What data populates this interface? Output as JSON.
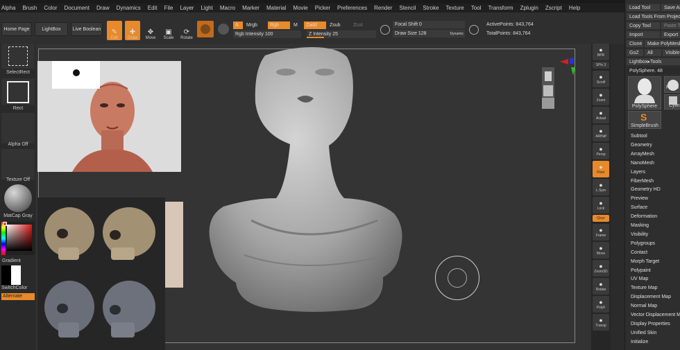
{
  "menu": [
    "Alpha",
    "Brush",
    "Color",
    "Document",
    "Draw",
    "Dynamics",
    "Edit",
    "File",
    "Layer",
    "Light",
    "Macro",
    "Marker",
    "Material",
    "Movie",
    "Picker",
    "Preferences",
    "Render",
    "Stencil",
    "Stroke",
    "Texture",
    "Tool",
    "Transform",
    "Zplugin",
    "Zscript",
    "Help"
  ],
  "toolbar": {
    "home_page": "Home Page",
    "lightbox": "LightBox",
    "live_boolean": "Live Boolean",
    "edit": "Edit",
    "draw": "Draw",
    "move": "Move",
    "scale": "Scale",
    "rotate": "Rotate",
    "a_toggle": "A",
    "mrgb": "Mrgb",
    "rgb": "Rgb",
    "m": "M",
    "zadd": "Zadd",
    "zsub": "Zsub",
    "zcut": "Zcut",
    "rgb_intensity_label": "Rgb Intensity",
    "rgb_intensity_value": "100",
    "z_intensity_label": "Z Intensity",
    "z_intensity_value": "25",
    "focal_shift_label": "Focal Shift",
    "focal_shift_value": "0",
    "draw_size_label": "Draw Size",
    "draw_size_value": "128",
    "dynamic": "Dynamic",
    "active_points_label": "ActivePoints:",
    "active_points_value": "843,764",
    "total_points_label": "TotalPoints:",
    "total_points_value": "843,764"
  },
  "left_tray": {
    "select_rect": "SelectRect",
    "rect": "Rect",
    "alpha_off": "Alpha Off",
    "texture_off": "Texture Off",
    "matcap": "MatCap Gray",
    "gradient": "Gradient",
    "switch_color": "SwitchColor",
    "alternate": "Alternate"
  },
  "right_shelf": [
    {
      "label": "BPR",
      "icon": "sphere-icon"
    },
    {
      "label": "SPix 3",
      "icon": ""
    },
    {
      "label": "Scroll",
      "icon": "scroll-icon"
    },
    {
      "label": "Zoom",
      "icon": "zoom-icon"
    },
    {
      "label": "Actual",
      "icon": "actual-icon"
    },
    {
      "label": "AAHalf",
      "icon": "aahalf-icon"
    },
    {
      "label": "Persp",
      "icon": "persp-icon"
    },
    {
      "label": "Floor",
      "icon": "floor-icon"
    },
    {
      "label": "L.Sym",
      "icon": "lsym-icon"
    },
    {
      "label": "Lock",
      "icon": "lock-icon"
    },
    {
      "label": "Qxyz",
      "icon": ""
    },
    {
      "label": "Frame",
      "icon": "frame-icon"
    },
    {
      "label": "Move",
      "icon": "hand-icon"
    },
    {
      "label": "Zoom3D",
      "icon": "zoom3d-icon"
    },
    {
      "label": "Rotate",
      "icon": "rotate-icon"
    },
    {
      "label": "PolyF",
      "icon": "polyf-icon"
    },
    {
      "label": "Transp",
      "icon": "transp-icon"
    }
  ],
  "tool_panel": {
    "load_tool": "Load Tool",
    "save_as": "Save As",
    "load_tools_from_project": "Load Tools From Project",
    "copy_tool": "Copy Tool",
    "paste_tool": "Paste T",
    "import": "Import",
    "export": "Export",
    "clone": "Clone",
    "make_polymesh": "Make PolyMesh3D",
    "goz": "GoZ",
    "all": "All",
    "visible": "Visible",
    "lightbox_tools": "Lightbox▸Tools",
    "current_tool": "PolySphere. 48",
    "thumb1_label": "PolySphere",
    "thumb2_label": "PolyS",
    "thumb3_label": "Cylin",
    "thumb4_label": "SimpleBrush",
    "subpalettes": [
      "Subtool",
      "Geometry",
      "ArrayMesh",
      "NanoMesh",
      "Layers",
      "FiberMesh",
      "Geometry HD",
      "Preview",
      "Surface",
      "Deformation",
      "Masking",
      "Visibility",
      "Polygroups",
      "Contact",
      "Morph Target",
      "Polypaint",
      "UV Map",
      "Texture Map",
      "Displacement Map",
      "Normal Map",
      "Vector Displacement Map",
      "Display Properties",
      "Unified Skin",
      "Initialize"
    ]
  },
  "colors": {
    "accent": "#e8892a",
    "panel": "#2e2e2e",
    "canvas": "#333333"
  }
}
